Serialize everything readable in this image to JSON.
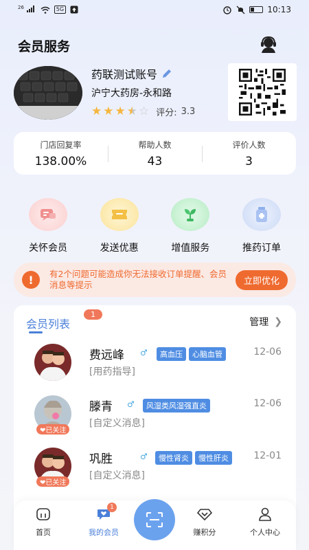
{
  "status_bar": {
    "signal_label": "26",
    "network_badge": "5G",
    "time": "10:13"
  },
  "header": {
    "title": "会员服务"
  },
  "store": {
    "name": "药联测试账号",
    "address": "沪宁大药房-永和路",
    "rating_label": "评分:",
    "rating_value": "3.3",
    "stars": 3.5
  },
  "stats": [
    {
      "label": "门店回复率",
      "value": "138.00%"
    },
    {
      "label": "帮助人数",
      "value": "43"
    },
    {
      "label": "评价人数",
      "value": "3"
    }
  ],
  "quick_actions": [
    {
      "label": "关怀会员",
      "icon": "care-message-icon",
      "color": "#f3a5a5"
    },
    {
      "label": "发送优惠",
      "icon": "coupon-icon",
      "color": "#f6cf63"
    },
    {
      "label": "增值服务",
      "icon": "sprout-icon",
      "color": "#5fcf7c"
    },
    {
      "label": "推药订单",
      "icon": "medicine-bottle-icon",
      "color": "#9fbcf2"
    }
  ],
  "notice": {
    "text": "有2个问题可能造成你无法接收订单提醒、会员消息等提示",
    "button": "立即优化"
  },
  "member_list": {
    "title": "会员列表",
    "badge": "1",
    "manage": "管理",
    "members": [
      {
        "name": "费远峰",
        "gender": "male",
        "tags": [
          "高血压",
          "心脑血管"
        ],
        "date": "12-06",
        "message": "[用药指导]",
        "followed": false,
        "follow_label": ""
      },
      {
        "name": "滕青",
        "gender": "male",
        "tags": [
          "风湿类风湿强直炎"
        ],
        "date": "12-06",
        "message": "[自定义消息]",
        "followed": true,
        "follow_label": "已关注"
      },
      {
        "name": "巩胜",
        "gender": "male",
        "tags": [
          "慢性肾炎",
          "慢性肝炎"
        ],
        "date": "12-01",
        "message": "[自定义消息]",
        "followed": true,
        "follow_label": "已关注"
      }
    ]
  },
  "tabbar": {
    "tabs": [
      {
        "label": "首页",
        "icon": "home-icon"
      },
      {
        "label": "我的会员",
        "icon": "chat-heart-icon",
        "badge": "1",
        "active": true
      },
      {
        "label": "赚积分",
        "icon": "diamond-icon"
      },
      {
        "label": "个人中心",
        "icon": "person-icon"
      }
    ]
  },
  "colors": {
    "accent": "#4a7fd9",
    "warning": "#ef6a2f",
    "badge": "#f0785a",
    "tag": "#4f8de3"
  }
}
